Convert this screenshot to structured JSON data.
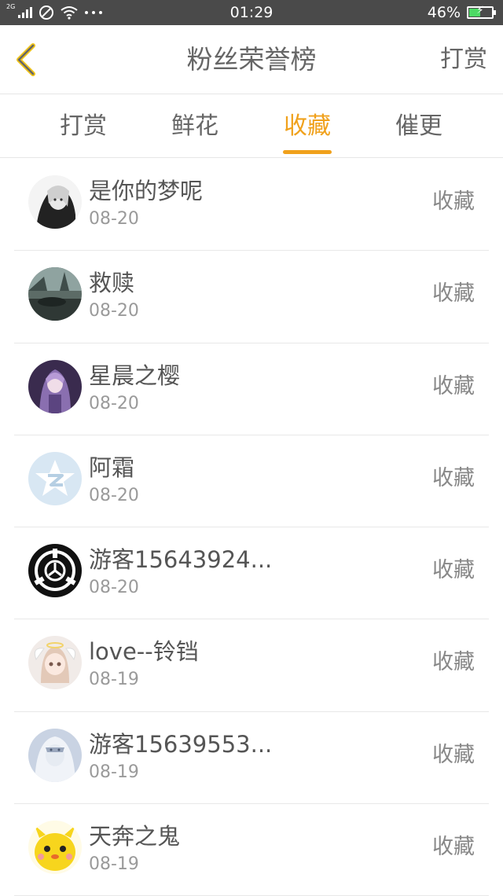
{
  "status_bar": {
    "network": "2G",
    "time": "01:29",
    "battery": "46%"
  },
  "header": {
    "title": "粉丝荣誉榜",
    "action": "打赏"
  },
  "tabs": [
    {
      "label": "打赏",
      "active": false
    },
    {
      "label": "鲜花",
      "active": false
    },
    {
      "label": "收藏",
      "active": true
    },
    {
      "label": "催更",
      "active": false
    }
  ],
  "colors": {
    "accent": "#f0a11c",
    "status_bar": "#4a4a4a",
    "text": "#555555",
    "subtext": "#9a9a9a"
  },
  "fans": [
    {
      "name": "是你的梦呢",
      "date": "08-20",
      "action": "收藏",
      "avatar": "anime-girl-avatar"
    },
    {
      "name": "救赎",
      "date": "08-20",
      "action": "收藏",
      "avatar": "city-scene-avatar"
    },
    {
      "name": "星晨之樱",
      "date": "08-20",
      "action": "收藏",
      "avatar": "purple-anime-avatar"
    },
    {
      "name": "阿霜",
      "date": "08-20",
      "action": "收藏",
      "avatar": "qq-star-avatar"
    },
    {
      "name": "游客15643924...",
      "date": "08-20",
      "action": "收藏",
      "avatar": "scp-logo-avatar"
    },
    {
      "name": "love--铃铛",
      "date": "08-19",
      "action": "收藏",
      "avatar": "angel-girl-avatar"
    },
    {
      "name": "游客15639553...",
      "date": "08-19",
      "action": "收藏",
      "avatar": "white-hair-avatar"
    },
    {
      "name": "天奔之鬼",
      "date": "08-19",
      "action": "收藏",
      "avatar": "yellow-chick-avatar"
    }
  ]
}
